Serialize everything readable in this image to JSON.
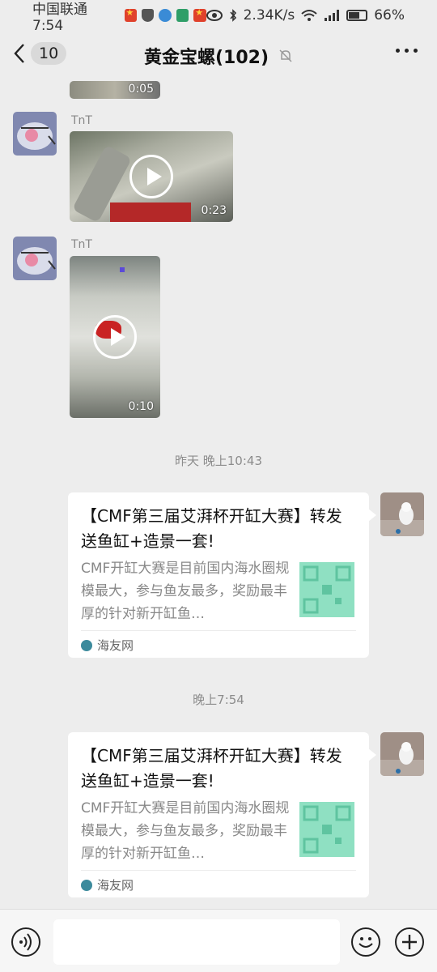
{
  "status": {
    "carrier_time": "中国联通 7:54",
    "net_speed": "2.34K/s",
    "battery": "66%",
    "battery_level": 0.66
  },
  "header": {
    "back_count": "10",
    "title": "黄金宝螺(102)",
    "mute_icon": "bell-off-icon",
    "more_icon": "more-dots-icon"
  },
  "messages": {
    "partial_video": {
      "duration": "0:05"
    },
    "video1": {
      "sender": "TnT",
      "duration": "0:23"
    },
    "video2": {
      "sender": "TnT",
      "duration": "0:10"
    },
    "time1": "昨天 晚上10:43",
    "card1": {
      "title": "【CMF第三届艾湃杯开缸大赛】转发送鱼缸+造景一套!",
      "desc": "CMF开缸大赛是目前国内海水圈规模最大，参与鱼友最多，奖励最丰厚的针对新开缸鱼…",
      "source": "海友网"
    },
    "time2": "晚上7:54",
    "card2": {
      "title": "【CMF第三届艾湃杯开缸大赛】转发送鱼缸+造景一套!",
      "desc": "CMF开缸大赛是目前国内海水圈规模最大，参与鱼友最多，奖励最丰厚的针对新开缸鱼…",
      "source": "海友网"
    }
  },
  "input_bar": {
    "voice_icon": "voice-icon",
    "emoji_icon": "emoji-icon",
    "plus_icon": "plus-icon"
  }
}
